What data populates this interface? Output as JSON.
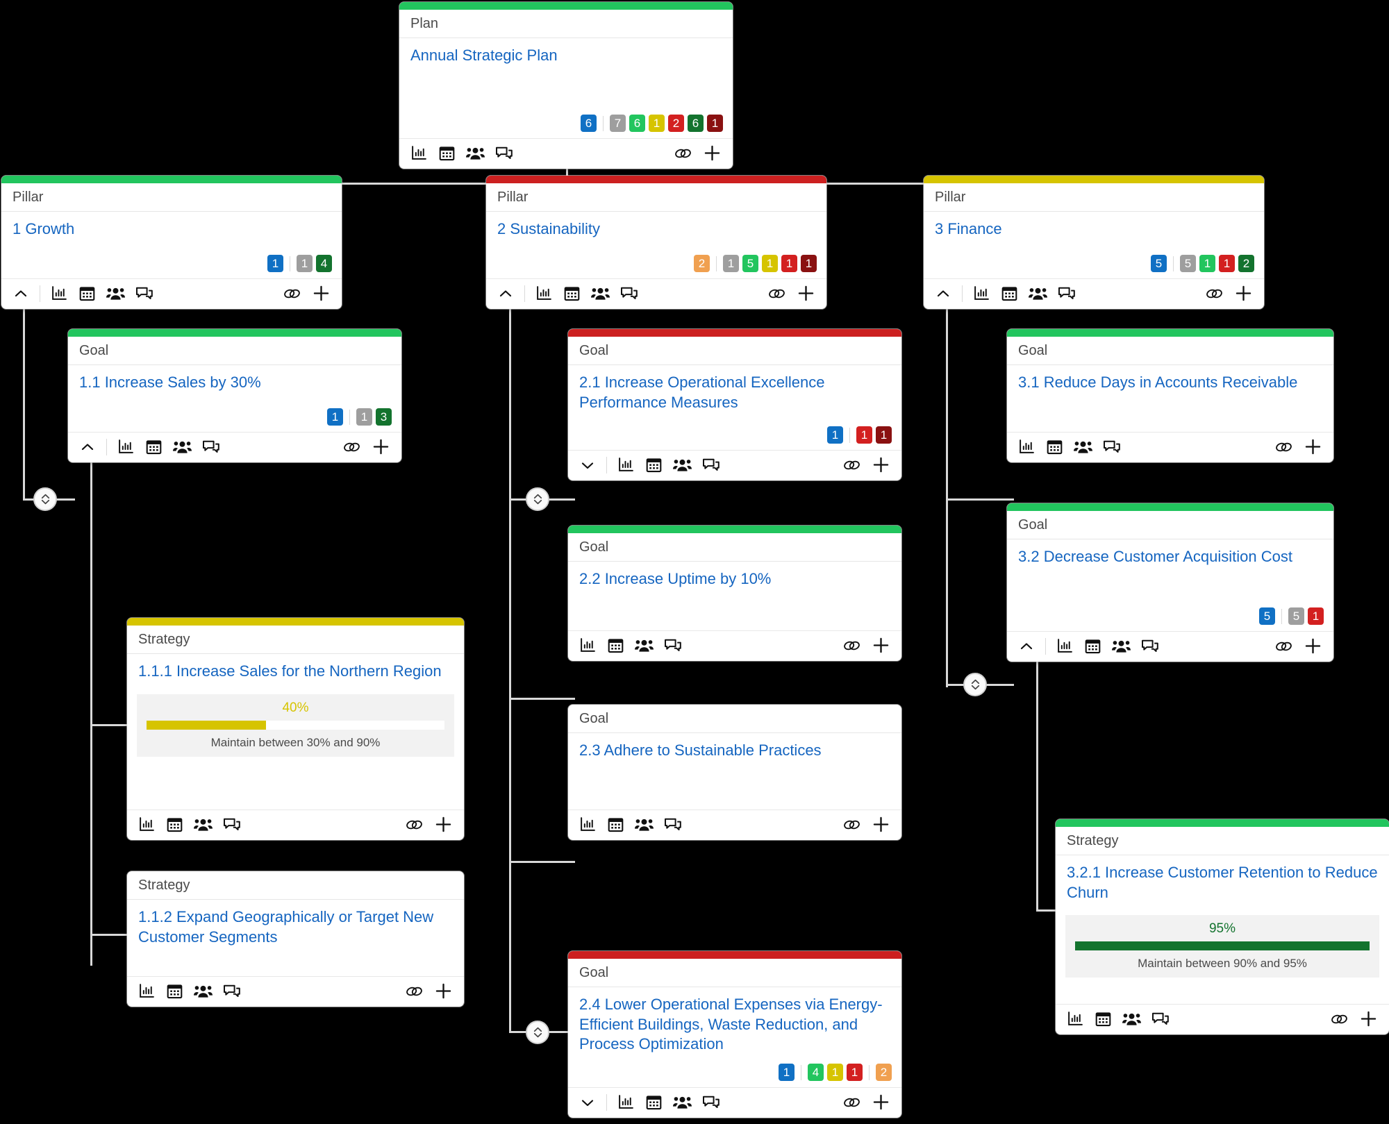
{
  "colors": {
    "green": "#22c55e",
    "red": "#cc2020",
    "yellow": "#d6c400",
    "blue_badge": "#1070c4",
    "gray_badge": "#9e9e9e",
    "green_badge": "#22c55e",
    "yellow_badge": "#d6c400",
    "red_badge": "#d32020",
    "darkgreen_badge": "#13732e",
    "darkred_badge": "#8a1111",
    "orange_badge": "#f0a050",
    "link_blue": "#1565c0",
    "progress_yellow": "#d6c400",
    "progress_green": "#13732e"
  },
  "icons": {
    "chart": "chart-icon",
    "calendar": "calendar-icon",
    "people": "people-icon",
    "comment": "comment-icon",
    "link": "link-icon",
    "plus": "plus-icon",
    "chevron_up": "chevron-up-icon",
    "chevron_down": "chevron-down-icon",
    "expand_toggle": "expand-collapse-icon"
  },
  "cards": {
    "plan": {
      "type": "Plan",
      "title": "Annual Strategic Plan",
      "bar": "green",
      "collapse": "none",
      "badges": [
        {
          "v": "6",
          "c": "blue_badge"
        },
        {
          "sep": true
        },
        {
          "v": "7",
          "c": "gray_badge"
        },
        {
          "v": "6",
          "c": "green_badge"
        },
        {
          "v": "1",
          "c": "yellow_badge"
        },
        {
          "v": "2",
          "c": "red_badge"
        },
        {
          "v": "6",
          "c": "darkgreen_badge"
        },
        {
          "v": "1",
          "c": "darkred_badge"
        }
      ]
    },
    "pillar1": {
      "type": "Pillar",
      "title": "1 Growth",
      "bar": "green",
      "collapse": "up",
      "badges": [
        {
          "v": "1",
          "c": "blue_badge"
        },
        {
          "sep": true
        },
        {
          "v": "1",
          "c": "gray_badge"
        },
        {
          "v": "4",
          "c": "darkgreen_badge"
        }
      ]
    },
    "pillar2": {
      "type": "Pillar",
      "title": "2 Sustainability",
      "bar": "red",
      "collapse": "up",
      "badges": [
        {
          "v": "2",
          "c": "orange_badge"
        },
        {
          "sep": true
        },
        {
          "v": "1",
          "c": "gray_badge"
        },
        {
          "v": "5",
          "c": "green_badge"
        },
        {
          "v": "1",
          "c": "yellow_badge"
        },
        {
          "v": "1",
          "c": "red_badge"
        },
        {
          "v": "1",
          "c": "darkred_badge"
        }
      ]
    },
    "pillar3": {
      "type": "Pillar",
      "title": "3 Finance",
      "bar": "yellow",
      "collapse": "up",
      "badges": [
        {
          "v": "5",
          "c": "blue_badge"
        },
        {
          "sep": true
        },
        {
          "v": "5",
          "c": "gray_badge"
        },
        {
          "v": "1",
          "c": "green_badge"
        },
        {
          "v": "1",
          "c": "red_badge"
        },
        {
          "v": "2",
          "c": "darkgreen_badge"
        }
      ]
    },
    "goal11": {
      "type": "Goal",
      "title": "1.1 Increase Sales by 30%",
      "bar": "green",
      "collapse": "up",
      "badges": [
        {
          "v": "1",
          "c": "blue_badge"
        },
        {
          "sep": true
        },
        {
          "v": "1",
          "c": "gray_badge"
        },
        {
          "v": "3",
          "c": "darkgreen_badge"
        }
      ]
    },
    "strategy111": {
      "type": "Strategy",
      "title": "1.1.1 Increase Sales for the Northern Region",
      "bar": "yellow",
      "collapse": "none",
      "badges": [],
      "progress": {
        "percent": "40%",
        "fill": 40,
        "note": "Maintain between 30% and 90%",
        "color": "progress_yellow"
      }
    },
    "strategy112": {
      "type": "Strategy",
      "title": "1.1.2 Expand Geographically or Target New Customer Segments",
      "bar": "none",
      "collapse": "none",
      "badges": []
    },
    "goal21": {
      "type": "Goal",
      "title": "2.1 Increase Operational Excellence Performance Measures",
      "bar": "red",
      "collapse": "down",
      "badges": [
        {
          "v": "1",
          "c": "blue_badge"
        },
        {
          "sep": true
        },
        {
          "v": "1",
          "c": "red_badge"
        },
        {
          "v": "1",
          "c": "darkred_badge"
        }
      ]
    },
    "goal22": {
      "type": "Goal",
      "title": "2.2 Increase Uptime by 10%",
      "bar": "green",
      "collapse": "none",
      "badges": []
    },
    "goal23": {
      "type": "Goal",
      "title": "2.3 Adhere to Sustainable Practices",
      "bar": "none",
      "collapse": "none",
      "badges": []
    },
    "goal24": {
      "type": "Goal",
      "title": "2.4 Lower Operational Expenses via Energy-Efficient Buildings, Waste Reduction, and Process Optimization",
      "bar": "red",
      "collapse": "down",
      "badges": [
        {
          "v": "1",
          "c": "blue_badge"
        },
        {
          "sep": true
        },
        {
          "v": "4",
          "c": "green_badge"
        },
        {
          "v": "1",
          "c": "yellow_badge"
        },
        {
          "v": "1",
          "c": "red_badge"
        },
        {
          "sep": true
        },
        {
          "v": "2",
          "c": "orange_badge"
        }
      ]
    },
    "goal31": {
      "type": "Goal",
      "title": "3.1 Reduce Days in Accounts Receivable",
      "bar": "green",
      "collapse": "none",
      "badges": []
    },
    "goal32": {
      "type": "Goal",
      "title": "3.2 Decrease Customer Acquisition Cost",
      "bar": "green",
      "collapse": "up",
      "badges": [
        {
          "v": "5",
          "c": "blue_badge"
        },
        {
          "sep": true
        },
        {
          "v": "5",
          "c": "gray_badge"
        },
        {
          "v": "1",
          "c": "red_badge"
        }
      ]
    },
    "strategy321": {
      "type": "Strategy",
      "title": "3.2.1 Increase Customer Retention to Reduce Churn",
      "bar": "green",
      "collapse": "none",
      "badges": [],
      "progress": {
        "percent": "95%",
        "fill": 100,
        "note": "Maintain between 90% and 95%",
        "color": "progress_green"
      }
    }
  }
}
